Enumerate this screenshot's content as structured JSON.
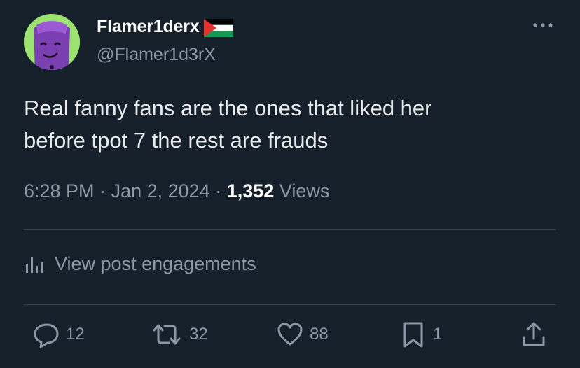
{
  "author": {
    "display_name": "Flamer1derx",
    "handle": "@Flamer1d3rX"
  },
  "tweet": {
    "text_line1": "Real fanny fans are the ones that liked her",
    "text_line2": "before tpot 7 the rest are frauds",
    "time": "6:28 PM",
    "date": "Jan 2, 2024",
    "views_count": "1,352",
    "views_label": "Views",
    "separator": "·"
  },
  "engagements": {
    "label": "View post engagements"
  },
  "actions": {
    "replies": "12",
    "reposts": "32",
    "likes": "88",
    "bookmarks": "1"
  },
  "colors": {
    "background": "#15202b",
    "secondary_text": "#8b98a5",
    "divider": "#38444d"
  },
  "icons": [
    "more-icon",
    "palestine-flag-icon",
    "analytics-icon",
    "reply-icon",
    "repost-icon",
    "like-icon",
    "bookmark-icon",
    "share-icon"
  ]
}
